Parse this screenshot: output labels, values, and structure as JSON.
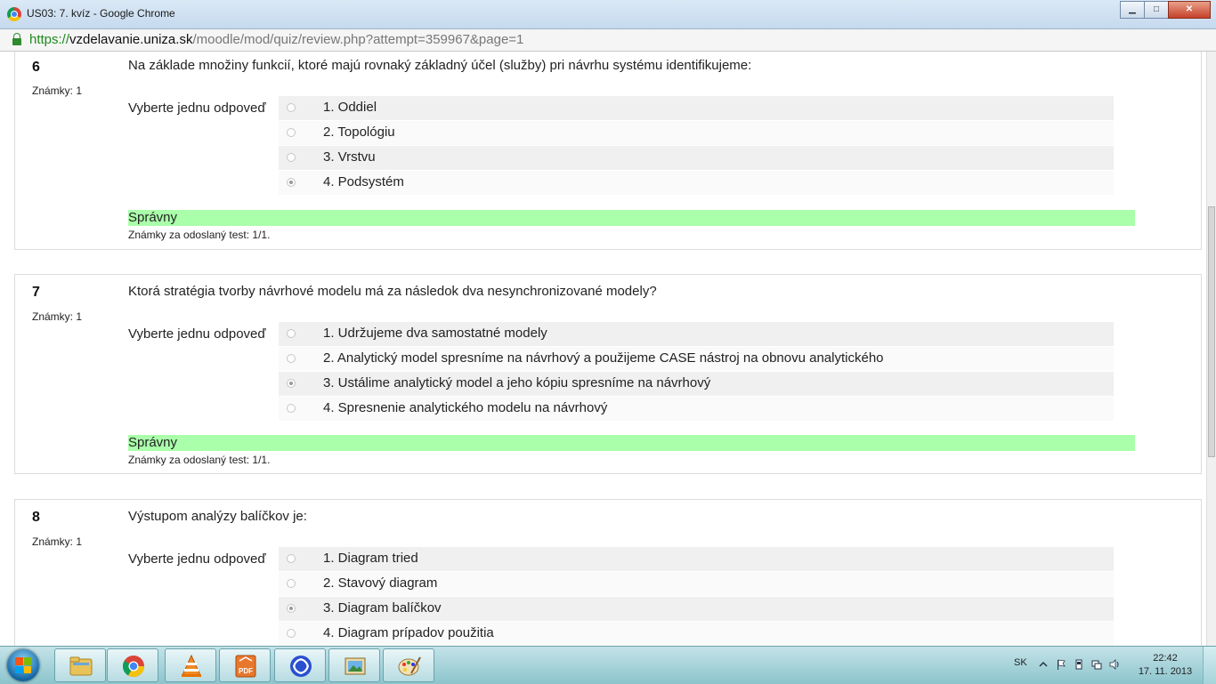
{
  "window": {
    "title": "US03: 7. kvíz - Google Chrome"
  },
  "address": {
    "scheme": "https://",
    "host": "vzdelavanie.uniza.sk",
    "path": "/moodle/mod/quiz/review.php?attempt=359967&page=1"
  },
  "questions": [
    {
      "number": "6",
      "grade": "Známky: 1",
      "text": "Na základe množiny funkcií, ktoré majú rovnaký základný účel (služby) pri návrhu systému identifikujeme:",
      "prompt": "Vyberte jednu odpoveď",
      "answers": [
        {
          "label": "1. Oddiel",
          "checked": false
        },
        {
          "label": "2. Topológiu",
          "checked": false
        },
        {
          "label": "3. Vrstvu",
          "checked": false
        },
        {
          "label": "4. Podsystém",
          "checked": true
        }
      ],
      "feedback": "Správny",
      "grade_feedback": "Známky za odoslaný test: 1/1."
    },
    {
      "number": "7",
      "grade": "Známky: 1",
      "text": "Ktorá stratégia tvorby návrhové modelu má za následok dva nesynchronizované modely?",
      "prompt": "Vyberte jednu odpoveď",
      "answers": [
        {
          "label": "1. Udržujeme dva samostatné modely",
          "checked": false
        },
        {
          "label": "2. Analytický model spresníme na návrhový a použijeme CASE nástroj na obnovu analytického",
          "checked": false
        },
        {
          "label": "3. Ustálime analytický model a jeho kópiu spresníme na návrhový",
          "checked": true
        },
        {
          "label": "4. Spresnenie analytického modelu na návrhový",
          "checked": false
        }
      ],
      "feedback": "Správny",
      "grade_feedback": "Známky za odoslaný test: 1/1."
    },
    {
      "number": "8",
      "grade": "Známky: 1",
      "text": "Výstupom analýzy balíčkov je:",
      "prompt": "Vyberte jednu odpoveď",
      "answers": [
        {
          "label": "1. Diagram tried",
          "checked": false
        },
        {
          "label": "2. Stavový diagram",
          "checked": false
        },
        {
          "label": "3. Diagram balíčkov",
          "checked": true
        },
        {
          "label": "4. Diagram prípadov použitia",
          "checked": false
        }
      ]
    }
  ],
  "taskbar": {
    "apps": [
      "file-explorer-icon",
      "chrome-icon",
      "vlc-icon",
      "pdf-icon",
      "app-icon",
      "image-viewer-icon",
      "paint-icon"
    ],
    "language": "SK",
    "time": "22:42",
    "date": "17. 11. 2013"
  },
  "colors": {
    "feedback_correct": "#aaffaa",
    "answer_row": "#f0f0f0",
    "taskbar": "#a9d6dd"
  }
}
